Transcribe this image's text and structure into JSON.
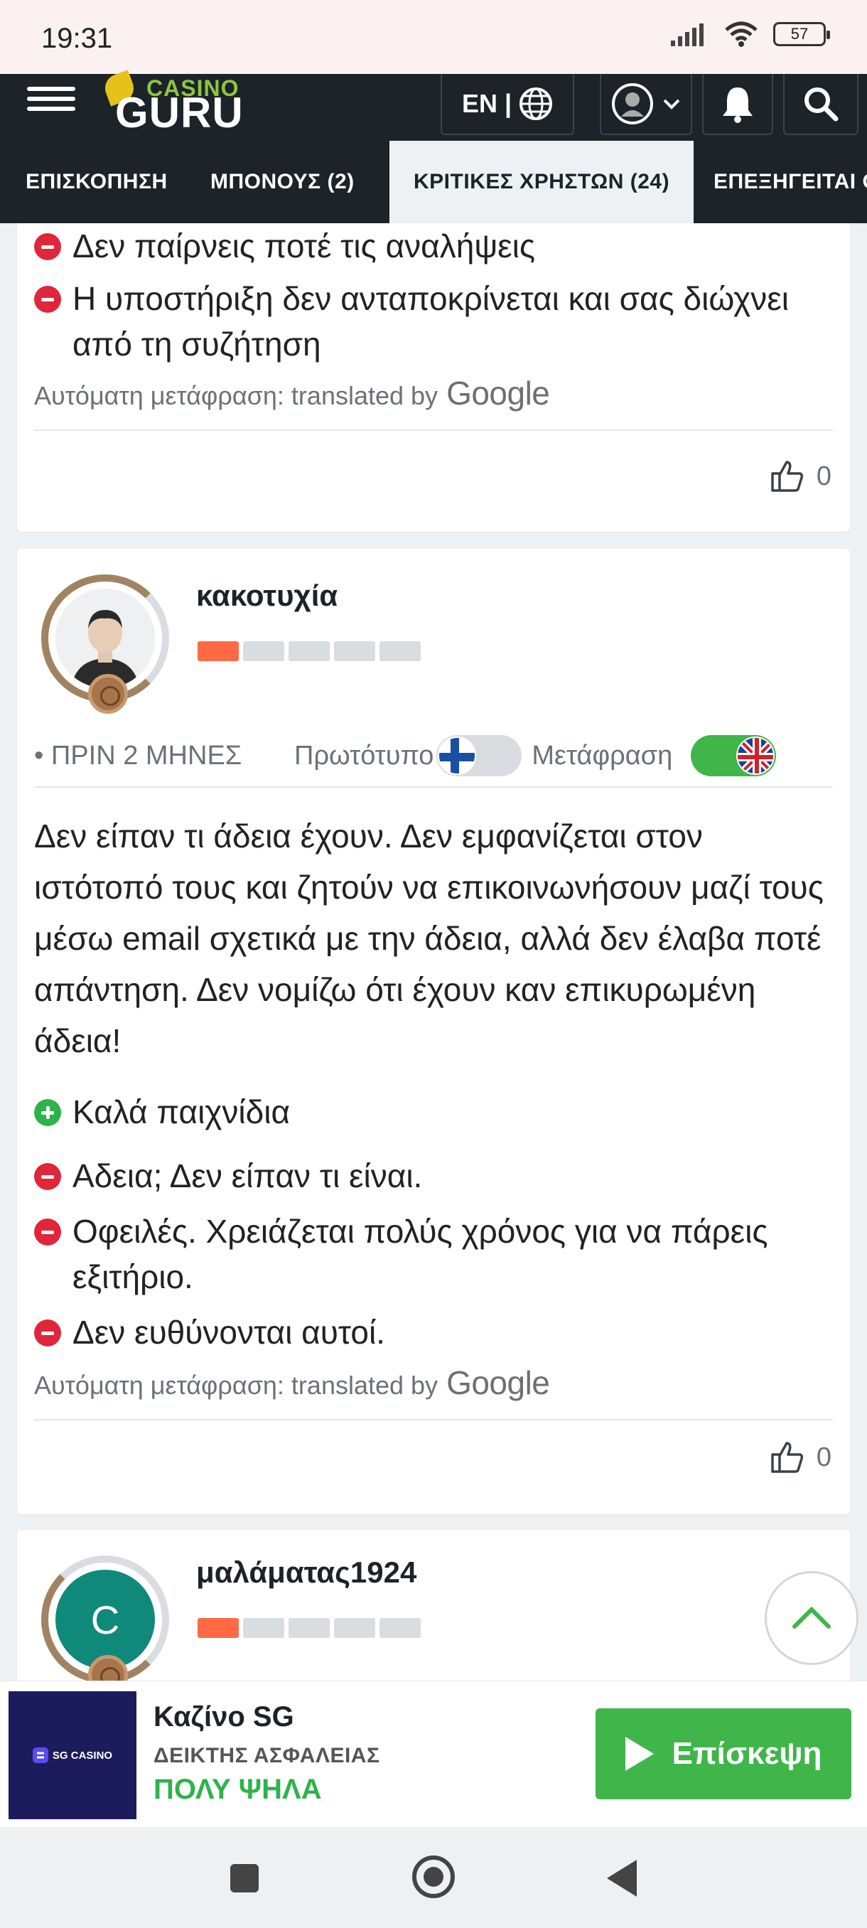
{
  "status_bar": {
    "time": "19:31",
    "battery": "57"
  },
  "nav": {
    "language": "EN |"
  },
  "tabs": [
    {
      "label": "ΕΠΙΣΚΟΠΗΣΗ"
    },
    {
      "label": "ΜΠΟΝΟΥΣ  (2)"
    },
    {
      "label": "ΚΡΙΤΙΚΕΣ ΧΡΗΣΤΩΝ (24)"
    },
    {
      "label": "ΕΠΕΞΗΓΕΙΤΑΙ Ο"
    }
  ],
  "review1": {
    "cons": [
      "Δεν παίρνεις ποτέ τις αναλήψεις",
      "Η υποστήριξη δεν ανταποκρίνεται και σας διώχνει από τη συζήτηση"
    ],
    "translation_note": "Αυτόματη μετάφραση: translated by",
    "google": "Google",
    "likes": "0"
  },
  "review2": {
    "username": "κακοτυχία",
    "level": 1,
    "time_ago": "• ΠΡΙΝ 2 ΜΗΝΕΣ",
    "original_label": "Πρωτότυπο",
    "translation_label": "Μετάφραση",
    "text": "Δεν είπαν τι άδεια έχουν. Δεν εμφανίζεται στον ιστότοπό τους και ζητούν να επικοινωνήσουν μαζί τους μέσω email σχετικά με την άδεια, αλλά δεν έλαβα ποτέ απάντηση. Δεν νομίζω ότι έχουν καν επικυρωμένη άδεια!",
    "pros": [
      "Καλά παιχνίδια"
    ],
    "cons": [
      "Αδεια; Δεν είπαν τι είναι.",
      "Οφειλές. Χρειάζεται πολύς χρόνος για να πάρεις εξιτήριο.",
      "Δεν ευθύνονται αυτοί."
    ],
    "translation_note": "Αυτόματη μετάφραση: translated by",
    "google": "Google",
    "likes": "0"
  },
  "review3": {
    "username": "μαλάματας1924",
    "avatar_letter": "C",
    "level": 1
  },
  "banner": {
    "logo_text": "SG CASINO",
    "casino_name": "Καζίνο SG",
    "safety_label": "ΔΕΙΚΤΗΣ ΑΣΦΑΛΕΙΑΣ",
    "safety_value": "ΠΟΛΥ ΨΗΛΑ",
    "visit_label": "Επίσκεψη"
  },
  "colors": {
    "accent_green": "#3fb54a",
    "nav_dark": "#1c2329",
    "con_red": "#e0263a",
    "level_orange": "#ff6a45"
  }
}
